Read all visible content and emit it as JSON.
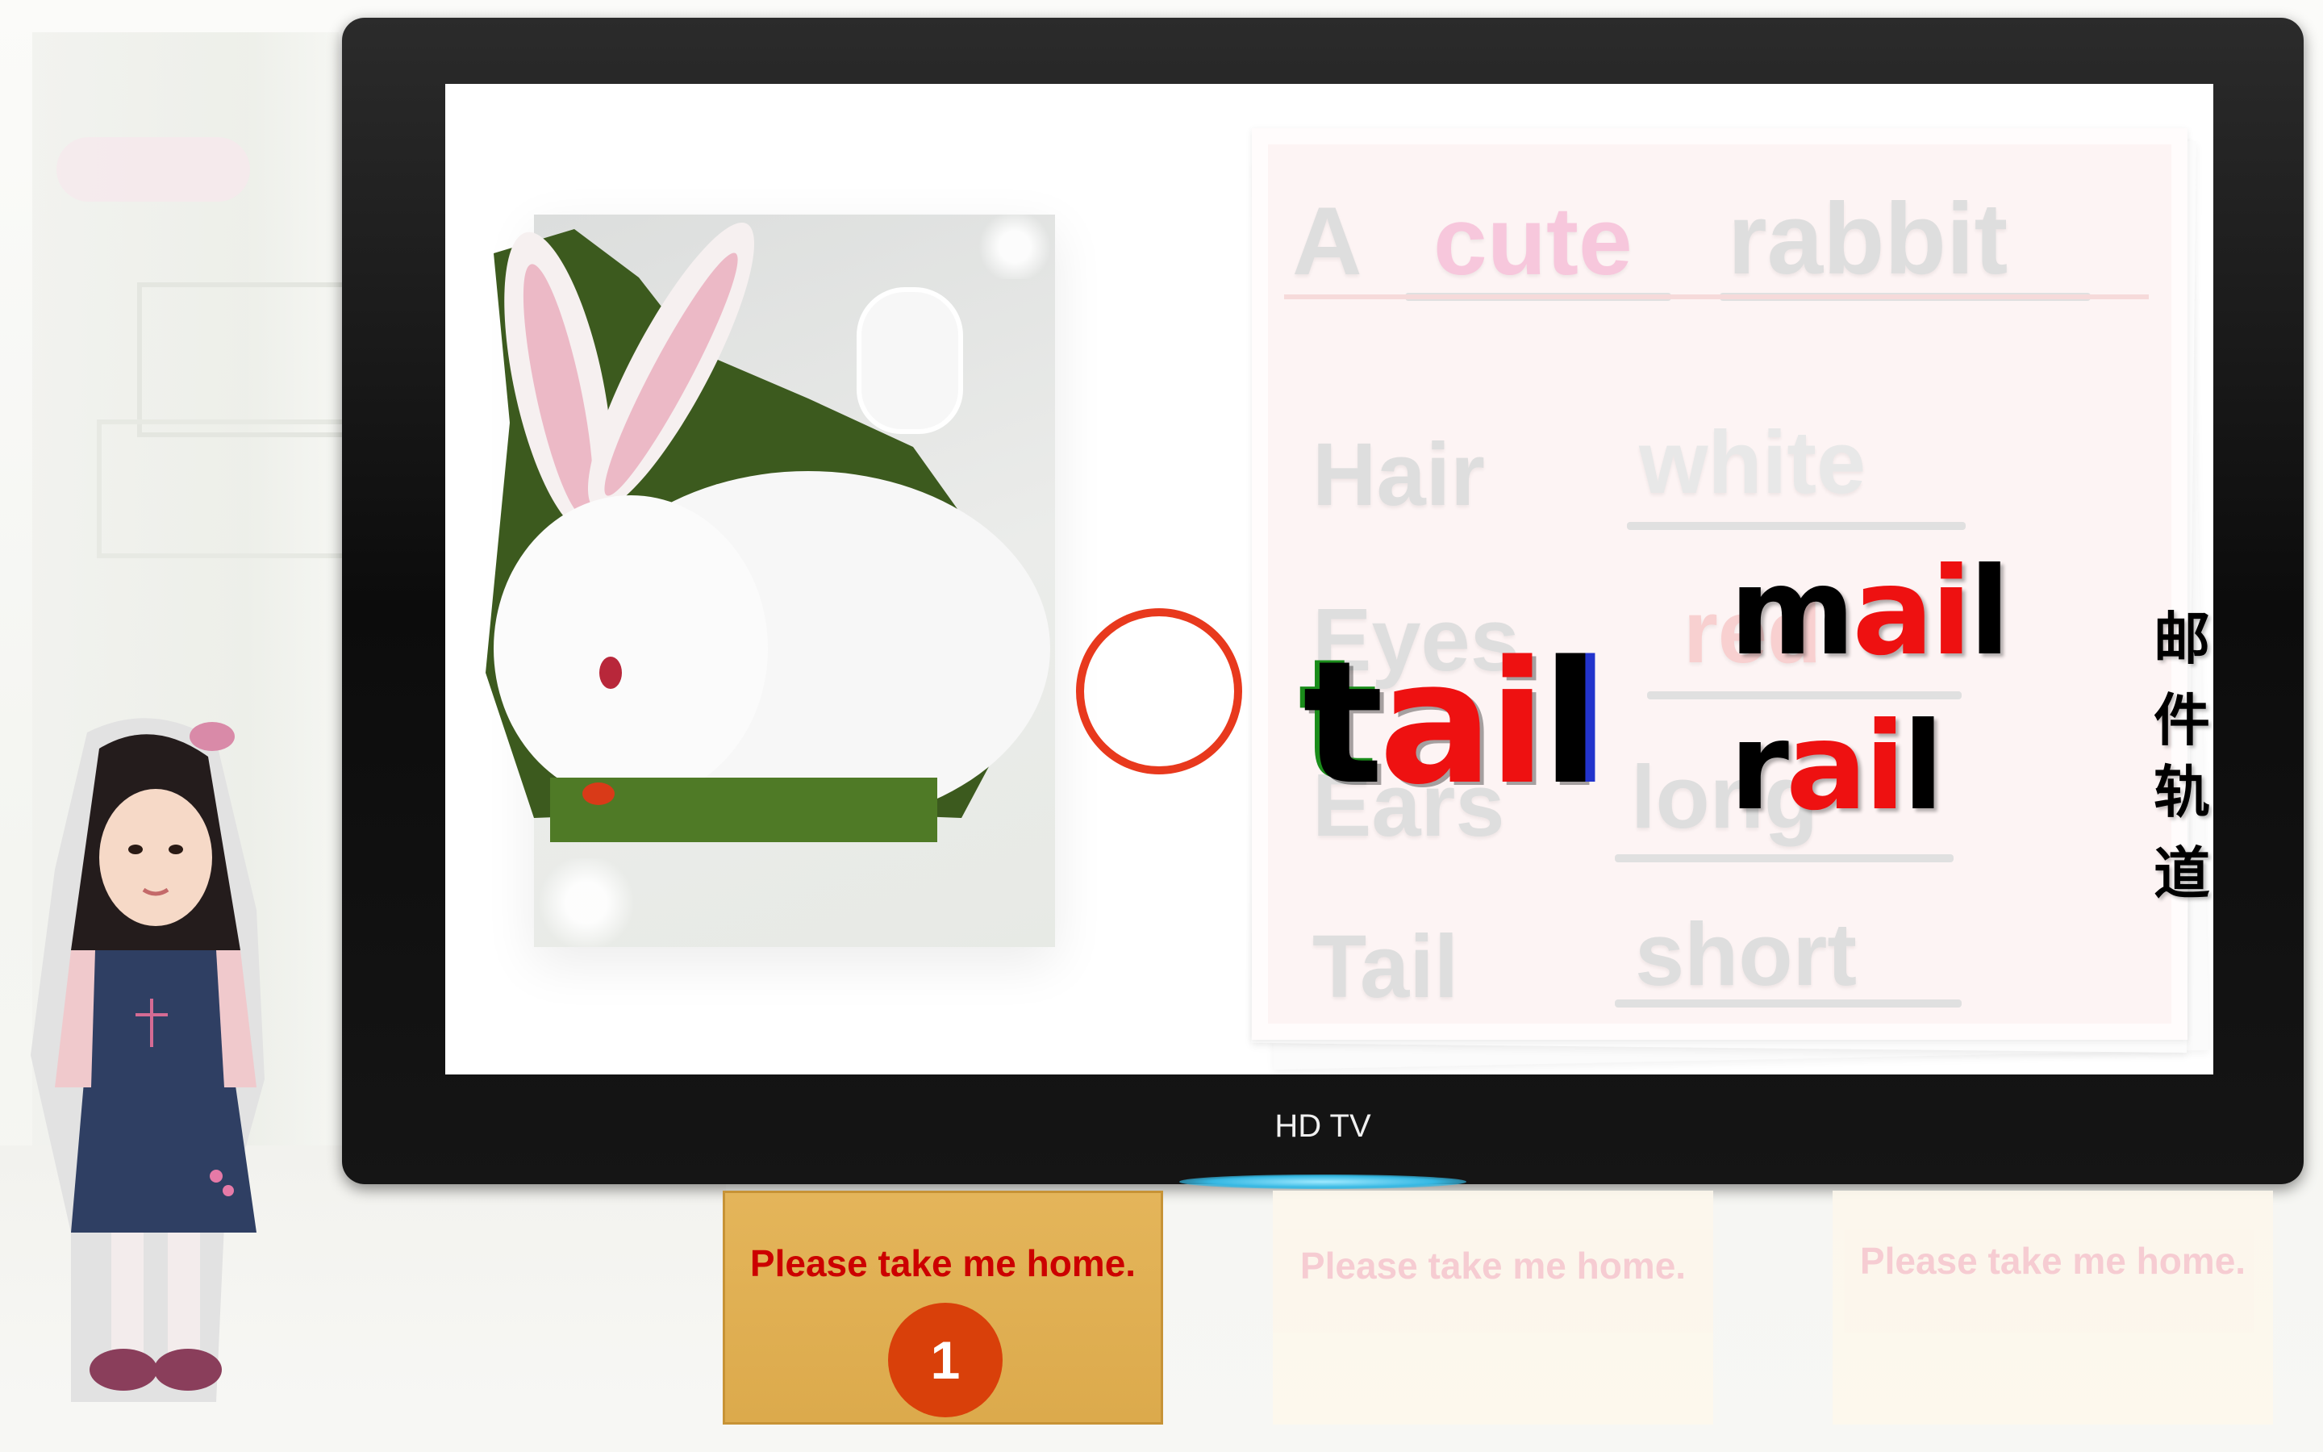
{
  "tv": {
    "brand": "HD TV"
  },
  "card": {
    "title": {
      "article": "A",
      "adjective": "cute",
      "noun": "rabbit"
    },
    "rows": [
      {
        "label": "Hair",
        "value": "white"
      },
      {
        "label": "Eyes",
        "value": "red"
      },
      {
        "label": "Ears",
        "value": "long"
      },
      {
        "label": "Tail",
        "value": "short"
      }
    ]
  },
  "phonics": {
    "main_word": {
      "onset": "t",
      "rime": "ai",
      "coda": "l"
    },
    "words": [
      {
        "onset": "m",
        "rime": "ai",
        "coda": "l",
        "meaning": "邮件"
      },
      {
        "onset": "r",
        "rime": "ai",
        "coda": "l",
        "meaning": "轨道"
      }
    ]
  },
  "home_cards": [
    {
      "text": "Please take me home.",
      "badge": "1",
      "state": "active"
    },
    {
      "text": "Please take me home.",
      "state": "faded"
    },
    {
      "text": "Please take me home.",
      "state": "faded"
    }
  ],
  "colors": {
    "highlight_circle": "#e8391d",
    "accent_red": "#ee1111",
    "active_card": "#e4b55a",
    "badge": "#d9400a"
  }
}
